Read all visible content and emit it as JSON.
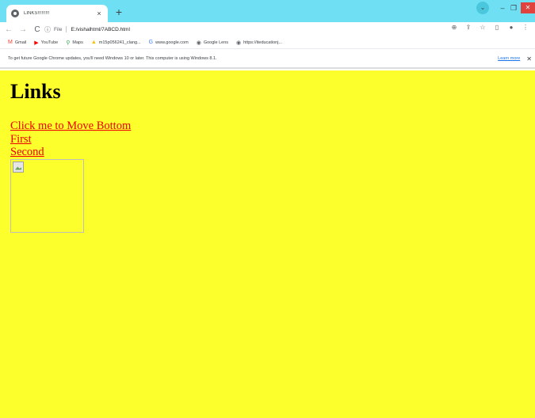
{
  "browser": {
    "tab": {
      "title": "LINKS!!!!!!!!!",
      "close": "×"
    },
    "newtab": "+",
    "window": {
      "tabsearch": "⌄",
      "minimize": "–",
      "restore": "❐",
      "close": "✕"
    },
    "toolbar": {
      "back": "←",
      "forward": "→",
      "reload": "C",
      "info_icon": "ⓘ",
      "scheme": "File",
      "url": "E:/vishalhtml/7ABCD.html",
      "zoom": "⊕",
      "share": "⇪",
      "star": "☆",
      "sidepanel": "▯",
      "profile": "●",
      "menu": "⋮"
    },
    "bookmarks": [
      {
        "icon": "M",
        "color": "#ea4335",
        "label": "Gmail"
      },
      {
        "icon": "▶",
        "color": "#ff0000",
        "label": "YouTube"
      },
      {
        "icon": "⚲",
        "color": "#34a853",
        "label": "Maps"
      },
      {
        "icon": "▲",
        "color": "#fbbc04",
        "label": "m15p056241_clang..."
      },
      {
        "icon": "G",
        "color": "#4285f4",
        "label": "www.google.com"
      },
      {
        "icon": "◉",
        "color": "#5f6368",
        "label": "Google Lens"
      },
      {
        "icon": "◉",
        "color": "#5f6368",
        "label": "https://iteducationj..."
      }
    ],
    "infobar": {
      "message": "To get future Google Chrome updates, you'll need Windows 10 or later. This computer is using Windows 8.1.",
      "learn_more": "Learn more",
      "close": "✕"
    }
  },
  "page": {
    "heading": "Links",
    "links": [
      "Click me to Move Bottom",
      "First",
      "Second"
    ],
    "background": "#fcff2b",
    "link_color": "#ee0000"
  }
}
